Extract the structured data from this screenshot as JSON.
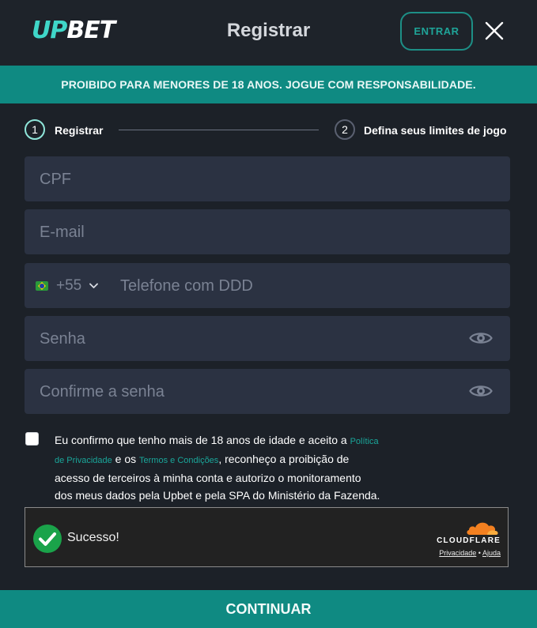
{
  "header": {
    "logo_part1": "UP",
    "logo_part2": "BET",
    "title": "Registrar",
    "login_label": "ENTRAR"
  },
  "banner": {
    "text": "PROIBIDO PARA MENORES DE 18 ANOS. JOGUE COM RESPONSABILIDADE."
  },
  "steps": [
    {
      "number": "1",
      "label": "Registrar",
      "active": true
    },
    {
      "number": "2",
      "label": "Defina seus limites de jogo",
      "active": false
    }
  ],
  "form": {
    "cpf_placeholder": "CPF",
    "email_placeholder": "E-mail",
    "phone_dial_code": "+55",
    "phone_placeholder": "Telefone com DDD",
    "password_placeholder": "Senha",
    "confirm_password_placeholder": "Confirme a senha"
  },
  "terms": {
    "checked": false,
    "part1": "Eu confirmo que tenho mais de 18 anos de idade e aceito a ",
    "link1_a": "Política",
    "link1_b": "de Privacidade",
    "part2": " e os ",
    "link2": "Termos e Condições",
    "part3": ", reconheço a proibição de",
    "line3": "acesso de terceiros à minha conta e autorizo o monitoramento",
    "line4": "dos meus dados pela Upbet e pela SPA do Ministério da Fazenda."
  },
  "captcha": {
    "status": "Sucesso!",
    "brand": "CLOUDFLARE",
    "privacy": "Privacidade",
    "separator": "•",
    "help": "Ajuda"
  },
  "continue_label": "CONTINUAR",
  "colors": {
    "accent": "#0f8a82",
    "background": "#1c2128",
    "field": "#2b3242",
    "link": "#1aa69a"
  }
}
